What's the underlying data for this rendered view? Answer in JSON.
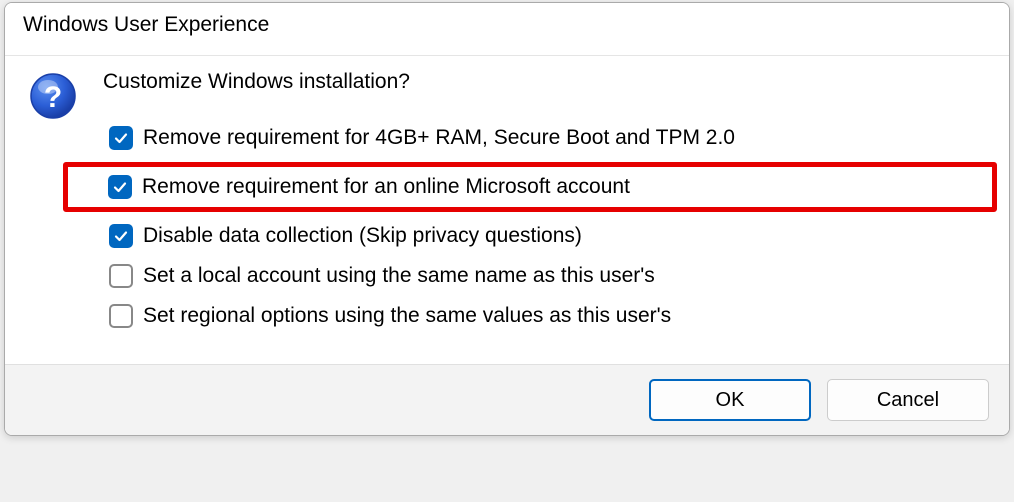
{
  "dialog": {
    "title": "Windows User Experience",
    "heading": "Customize Windows installation?",
    "options": [
      {
        "label": "Remove requirement for 4GB+ RAM, Secure Boot and TPM 2.0",
        "checked": true,
        "highlighted": false
      },
      {
        "label": "Remove requirement for an online Microsoft account",
        "checked": true,
        "highlighted": true
      },
      {
        "label": "Disable data collection (Skip privacy questions)",
        "checked": true,
        "highlighted": false
      },
      {
        "label": "Set a local account using the same name as this user's",
        "checked": false,
        "highlighted": false
      },
      {
        "label": "Set regional options using the same values as this user's",
        "checked": false,
        "highlighted": false
      }
    ],
    "buttons": {
      "ok": "OK",
      "cancel": "Cancel"
    }
  }
}
